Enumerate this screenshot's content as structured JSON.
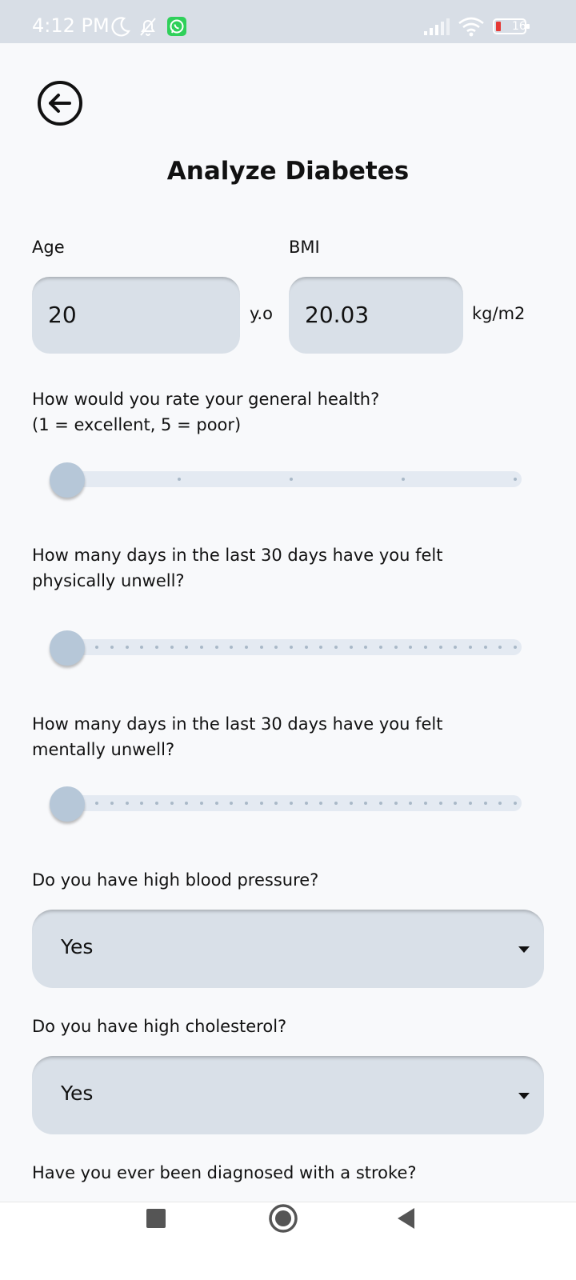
{
  "status_bar": {
    "time": "4:12 PM",
    "battery_level": "16",
    "icons": [
      "moon-icon",
      "bell-off-icon",
      "whatsapp-icon",
      "signal-icon",
      "wifi-icon",
      "battery-icon"
    ]
  },
  "header": {
    "back_icon": "arrow-left-circle-icon",
    "title": "Analyze Diabetes"
  },
  "fields": {
    "age": {
      "label": "Age",
      "value": "20",
      "unit": "y.o"
    },
    "bmi": {
      "label": "BMI",
      "value": "20.03",
      "unit": "kg/m2"
    }
  },
  "sliders": [
    {
      "question_line1": "How would you rate your general health?",
      "question_line2": "(1 = excellent, 5 = poor)",
      "min": 1,
      "max": 5,
      "value": 1
    },
    {
      "question_line1": "How many days in the last 30 days have you felt",
      "question_line2": "physically unwell?",
      "min": 0,
      "max": 30,
      "value": 0
    },
    {
      "question_line1": "How many days in the last 30 days have you felt",
      "question_line2": "mentally unwell?",
      "min": 0,
      "max": 30,
      "value": 0
    }
  ],
  "dropdowns": [
    {
      "question": "Do you have high blood pressure?",
      "selected": "Yes"
    },
    {
      "question": "Do you have high cholesterol?",
      "selected": "Yes"
    }
  ],
  "partial_question": "Have you ever been diagnosed with a stroke?",
  "nav": {
    "icons": [
      "recents-square-icon",
      "home-circle-icon",
      "back-triangle-icon"
    ]
  },
  "colors": {
    "status_bar_bg": "#d8dee6",
    "input_bg": "#d9e0e8",
    "slider_track": "#e4eaf2",
    "slider_thumb": "#b6c7d8",
    "page_bg": "#f8f9fb"
  }
}
